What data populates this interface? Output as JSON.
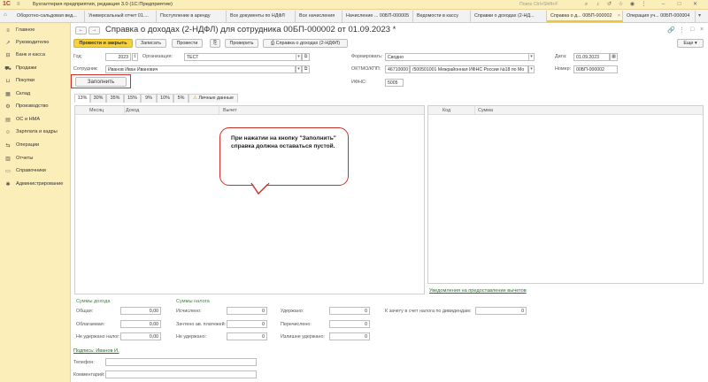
{
  "app": {
    "logo": "1С",
    "title": "Бухгалтерия предприятия, редакция 3.0  (1С:Предприятие)",
    "search_placeholder": "Поиск Ctrl+Shift+F"
  },
  "tabs": [
    "Оборотно-сальдовая вед...",
    "Универсальный отчет 01....",
    "Поступление в аренду",
    "Все документы по НДФЛ",
    "Все начисления",
    "Начисление ... 00БП-000005",
    "Ведомости в кассу",
    "Справки о доходах (2-НД...",
    "Справка о д... 00БП-000002",
    "Операция уч... 00БП-000004"
  ],
  "sidebar": {
    "items": [
      {
        "label": "Главное",
        "icon": "menu-icon"
      },
      {
        "label": "Руководителю",
        "icon": "chart-line-icon"
      },
      {
        "label": "Банк и касса",
        "icon": "bank-icon"
      },
      {
        "label": "Продажи",
        "icon": "cart-icon"
      },
      {
        "label": "Покупки",
        "icon": "basket-icon"
      },
      {
        "label": "Склад",
        "icon": "warehouse-icon"
      },
      {
        "label": "Производство",
        "icon": "factory-icon"
      },
      {
        "label": "ОС и НМА",
        "icon": "assets-icon"
      },
      {
        "label": "Зарплата и кадры",
        "icon": "people-icon"
      },
      {
        "label": "Операции",
        "icon": "operations-icon"
      },
      {
        "label": "Отчеты",
        "icon": "reports-icon"
      },
      {
        "label": "Справочники",
        "icon": "book-icon"
      },
      {
        "label": "Администрирование",
        "icon": "gear-icon"
      }
    ]
  },
  "doc": {
    "title": "Справка о доходах (2-НДФЛ) для сотрудника 00БП-000002 от 01.09.2023 *"
  },
  "toolbar": {
    "post_close": "Провести и закрыть",
    "save": "Записать",
    "post": "Провести",
    "verify": "Проверить",
    "print_cert": "Справка о доходах (2-НДФЛ)",
    "more": "Еще"
  },
  "form": {
    "year_label": "Год:",
    "year": "2023",
    "org_label": "Организация:",
    "org": "ТЕСТ",
    "employee_label": "Сотрудник:",
    "employee": "Иванов Иван Иванович",
    "form_label": "Формировать:",
    "form_value": "Сводно",
    "oktmo_label": "ОКТМО/КПП:",
    "oktmo": "46710000",
    "kpp": "/500501001 Межрайонная ИФНС России №18 по Мо",
    "ifns_label": "ИФНС:",
    "ifns": "5005",
    "date_label": "Дата:",
    "date": "01.09.2023",
    "number_label": "Номер:",
    "number": "00БП-000002",
    "fill_button": "Заполнить"
  },
  "rate_tabs": [
    "13%",
    "30%",
    "35%",
    "15%",
    "9%",
    "10%",
    "5%",
    "Личные данные"
  ],
  "income_grid": {
    "columns": [
      "Месяц",
      "Доход",
      "Вычет"
    ]
  },
  "deduction_grid": {
    "columns": [
      "Код",
      "Сумма"
    ]
  },
  "notifications_link": "Уведомления на предоставление вычетов",
  "totals": {
    "income_title": "Суммы дохода",
    "tax_title": "Суммы налога",
    "total_label": "Общая:",
    "total": "0,00",
    "taxable_label": "Облагаемая:",
    "taxable": "0,00",
    "not_withheld_label": "Не удержано налог:",
    "not_withheld": "0,00",
    "calculated_label": "Исчислено:",
    "calculated": "0",
    "offset_label": "Зачтено ав. платежей:",
    "offset": "0",
    "not_withheld2_label": "Не удержано:",
    "not_withheld2": "0",
    "withheld_label": "Удержано:",
    "withheld": "0",
    "transferred_label": "Перечислено:",
    "transferred": "0",
    "excess_label": "Излишне удержано:",
    "excess": "0",
    "dividend_label": "К зачету в счет налога по дивидендам:",
    "dividend": "0"
  },
  "signature_link": "Подпись: Иванов И.",
  "phone_label": "Телефон:",
  "comment_label": "Комментарий:",
  "callout": "При нажатии на кнопку \"Заполнить\" справка должна оставаться пустой.",
  "colors": {
    "accent": "#f5d13d",
    "sidebar": "#fbeeb8",
    "highlight": "#d32f2f",
    "link": "#1a7a1a"
  }
}
